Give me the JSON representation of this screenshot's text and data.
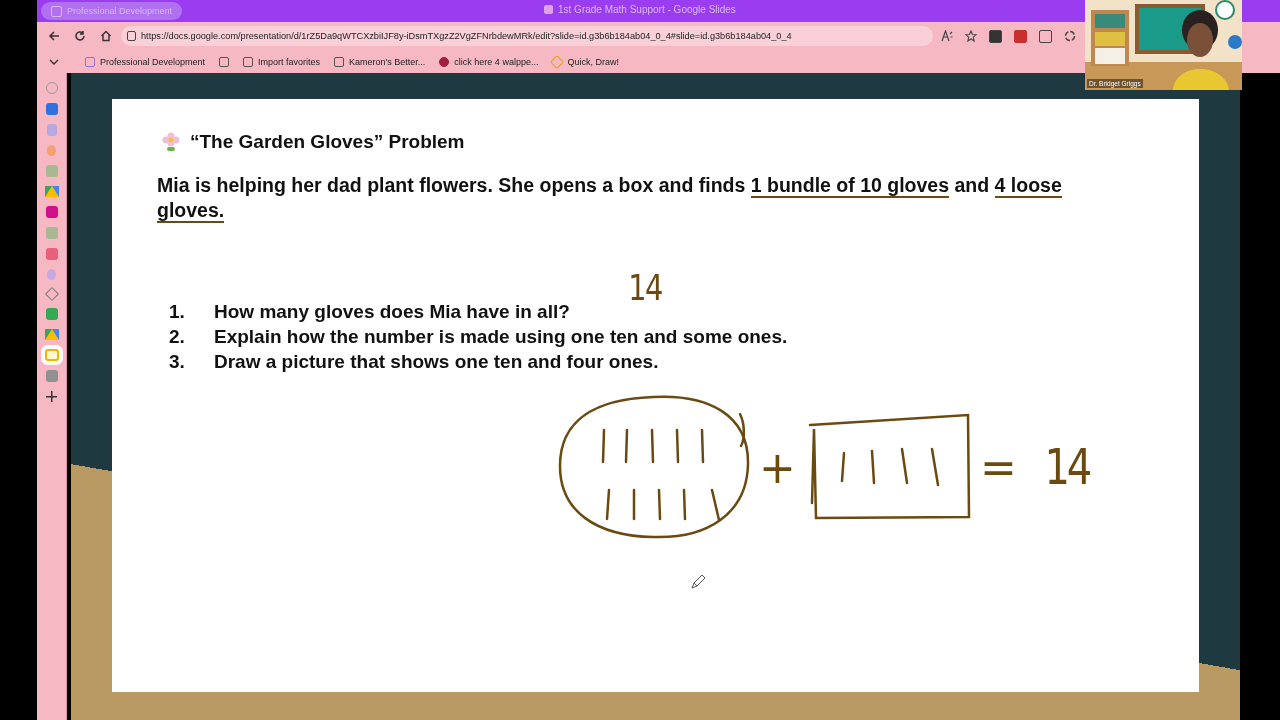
{
  "window": {
    "tab": "Professional Development",
    "title": "1st Grade Math Support - Google Slides"
  },
  "address_bar": {
    "url": "https://docs.google.com/presentation/d/1rZ5Da9qWTCXzbiIJF8y-iDsmTXgzZ2VgZFNrbdewMRk/edit?slide=id.g3b6b184ab04_0_4#slide=id.g3b6b184ab04_0_4"
  },
  "bookmarks": [
    {
      "kind": "hub",
      "label": "Professional Development"
    },
    {
      "kind": "display"
    },
    {
      "kind": "import",
      "label": "Import favorites"
    },
    {
      "kind": "folder",
      "label": "Kameron's Better..."
    },
    {
      "kind": "game",
      "label": "click here 4 walppe..."
    },
    {
      "kind": "draw",
      "label": "Quick, Draw!"
    }
  ],
  "sidebar": {
    "items": [
      {
        "kind": "globe",
        "selected": false
      },
      {
        "kind": "tile",
        "color": "#2f6fe0",
        "selected": false
      },
      {
        "kind": "doc",
        "color": "#b8a8e0",
        "selected": false
      },
      {
        "kind": "dot",
        "color": "#f4a070",
        "selected": false
      },
      {
        "kind": "tile",
        "color": "#a8b890",
        "selected": false
      },
      {
        "kind": "drive",
        "selected": false
      },
      {
        "kind": "tile",
        "color": "#d0108a",
        "selected": false
      },
      {
        "kind": "tile",
        "color": "#a8b890",
        "selected": false
      },
      {
        "kind": "tile",
        "color": "#e8607a",
        "selected": false
      },
      {
        "kind": "dot",
        "color": "#c8a8e0",
        "selected": false
      },
      {
        "kind": "layers",
        "selected": false
      },
      {
        "kind": "tile",
        "color": "#34a853",
        "selected": false
      },
      {
        "kind": "drive",
        "selected": false
      },
      {
        "kind": "slides",
        "selected": true
      },
      {
        "kind": "tile",
        "color": "#909090",
        "selected": false
      },
      {
        "kind": "add"
      }
    ]
  },
  "webcam": {
    "kind": "picture",
    "caption": "Dr. Bridget Griggs"
  },
  "slide": {
    "title": "“The Garden Gloves” Problem",
    "story": [
      {
        "text": "Mia is helping her dad plant flowers. She opens a box and finds ",
        "underlined": false
      },
      {
        "text": "1 bundle of 10 gloves",
        "underlined": true
      },
      {
        "text": " and ",
        "underlined": false
      },
      {
        "text": "4 loose ",
        "underlined": true
      },
      {
        "text": "gloves.",
        "underlined": true
      }
    ],
    "questions": [
      {
        "number": "1.",
        "text": "How many gloves does Mia have in all?"
      },
      {
        "number": "2.",
        "text": "Explain how the number is made using one ten and some ones."
      },
      {
        "number": "3.",
        "text": "Draw a picture that shows one ten and four ones."
      }
    ],
    "ink": {
      "answer": "14",
      "plus": "+",
      "equals": "=",
      "total": "14"
    }
  }
}
